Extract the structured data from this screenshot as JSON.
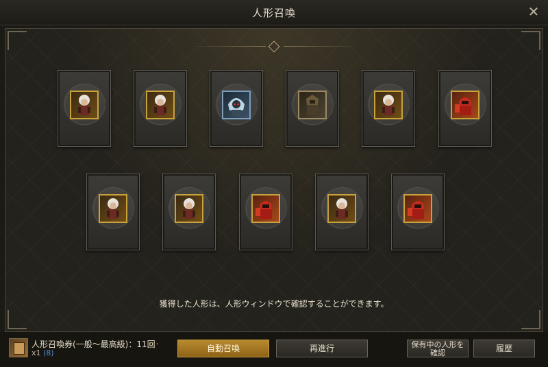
{
  "window": {
    "title": "人形召喚",
    "close_icon": "close-icon"
  },
  "results": {
    "cards": [
      {
        "icon": "white-hair-warrior-doll",
        "frame": "gold"
      },
      {
        "icon": "white-hair-warrior-doll",
        "frame": "gold"
      },
      {
        "icon": "blue-hooded-doll",
        "frame": "blue"
      },
      {
        "icon": "dark-armored-doll",
        "frame": "dark"
      },
      {
        "icon": "white-hair-warrior-doll",
        "frame": "gold"
      },
      {
        "icon": "red-armored-doll",
        "frame": "red"
      },
      {
        "icon": "white-hair-warrior-doll",
        "frame": "gold"
      },
      {
        "icon": "white-hair-warrior-doll",
        "frame": "gold"
      },
      {
        "icon": "red-armored-doll",
        "frame": "red"
      },
      {
        "icon": "white-hair-warrior-doll",
        "frame": "gold"
      },
      {
        "icon": "red-armored-doll",
        "frame": "red"
      }
    ],
    "info_text": "獲得した人形は、人形ウィンドウで確認することができます。"
  },
  "ticket": {
    "icon": "summon-ticket-icon",
    "name": "人形召喚券(一般〜最高級)：11回",
    "more": "...",
    "qty": "x1",
    "owned": "(8)"
  },
  "buttons": {
    "auto_summon": "自動召喚",
    "retry": "再進行",
    "check_owned_line1": "保有中の人形を",
    "check_owned_line2": "確認",
    "history": "履歴"
  },
  "colors": {
    "gold_frame": "#c9a23c",
    "blue_frame": "#7d9ec0",
    "primary_button": "#b98a2f",
    "owned_count": "#4f8fe0"
  }
}
